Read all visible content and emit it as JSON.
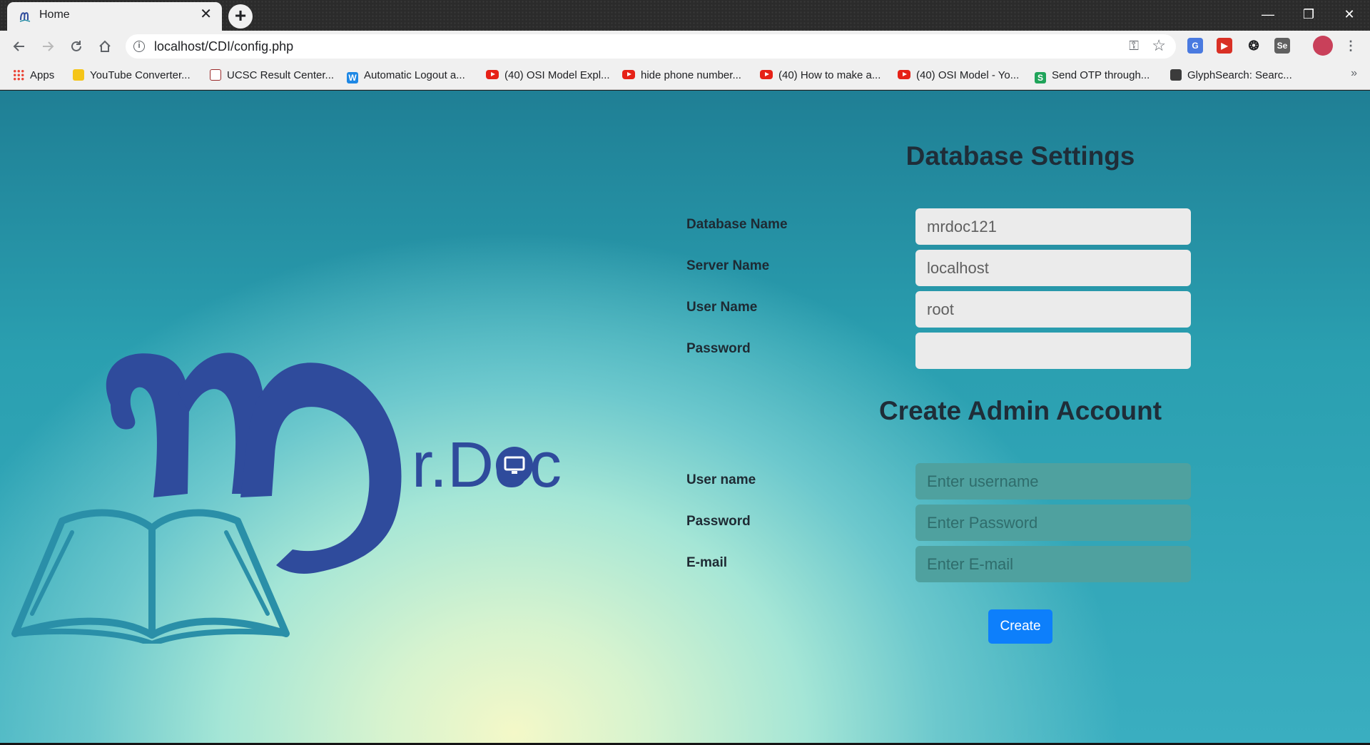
{
  "browser": {
    "tab_title": "Home",
    "tab_close": "✕",
    "new_tab": "+",
    "url": "localhost/CDI/config.php",
    "window_controls": {
      "minimize": "—",
      "restore": "❐",
      "close": "✕"
    },
    "nav_icons": [
      "back-icon",
      "forward-icon",
      "reload-icon",
      "home-icon"
    ],
    "extensions": [
      "google-translate-icon",
      "video-speed-icon",
      "refresh-extension-icon",
      "selenium-icon",
      "profile-avatar",
      "menu-icon"
    ]
  },
  "bookmarks": [
    {
      "label": "Apps",
      "icon": "apps-icon"
    },
    {
      "label": "YouTube Converter...",
      "icon": "converter-icon"
    },
    {
      "label": "UCSC Result Center...",
      "icon": "ucsc-icon"
    },
    {
      "label": "Automatic Logout a...",
      "icon": "wordpress-w-icon"
    },
    {
      "label": "(40) OSI Model Expl...",
      "icon": "youtube-icon"
    },
    {
      "label": "hide phone number...",
      "icon": "youtube-icon"
    },
    {
      "label": "(40) How to make a...",
      "icon": "youtube-icon"
    },
    {
      "label": "(40) OSI Model - Yo...",
      "icon": "youtube-icon"
    },
    {
      "label": "Send OTP through...",
      "icon": "s-green-icon"
    },
    {
      "label": "GlyphSearch: Searc...",
      "icon": "glyphsearch-icon"
    }
  ],
  "logo": {
    "text": "r.Doc",
    "brand_blue": "#2f4b9c",
    "book_teal": "#2a8fa8"
  },
  "database_settings": {
    "title": "Database Settings",
    "fields": [
      {
        "label": "Database Name",
        "value": "mrdoc121"
      },
      {
        "label": "Server Name",
        "value": "localhost"
      },
      {
        "label": "User Name",
        "value": "root"
      },
      {
        "label": "Password",
        "value": ""
      }
    ]
  },
  "admin_account": {
    "title": "Create Admin Account",
    "fields": [
      {
        "label": "User name",
        "placeholder": "Enter username"
      },
      {
        "label": "Password",
        "placeholder": "Enter Password"
      },
      {
        "label": "E-mail",
        "placeholder": "Enter E-mail"
      }
    ],
    "submit_label": "Create"
  },
  "colors": {
    "button_blue": "#0d7ffb",
    "input_teal": "#4fa19f"
  }
}
